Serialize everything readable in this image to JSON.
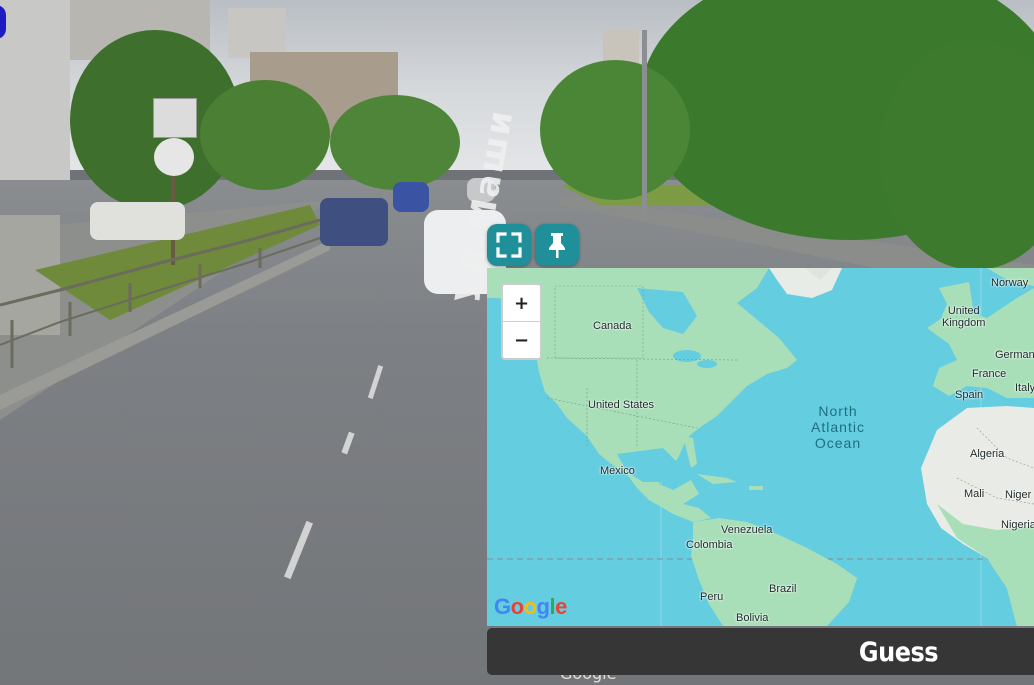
{
  "street_view": {
    "street_sign_text": "УЛ Маши",
    "watermark": "Google"
  },
  "map_tools": {
    "fullscreen_icon": "fullscreen-icon",
    "pin_icon": "pin-icon",
    "accent_color": "#1f8f9a"
  },
  "map": {
    "zoom_in": "+",
    "zoom_out": "−",
    "ocean_label": [
      "North",
      "Atlantic",
      "Ocean"
    ],
    "labels": {
      "canada": "Canada",
      "united_states": "United States",
      "mexico": "Mexico",
      "venezuela": "Venezuela",
      "colombia": "Colombia",
      "brazil": "Brazil",
      "peru": "Peru",
      "bolivia": "Bolivia",
      "norway": "Norway",
      "united_kingdom_1": "United",
      "united_kingdom_2": "Kingdom",
      "germany": "Germany",
      "france": "France",
      "italy": "Italy",
      "spain": "Spain",
      "algeria": "Algeria",
      "mali": "Mali",
      "niger": "Niger",
      "nigeria": "Nigeria"
    },
    "logo": {
      "letters": [
        "G",
        "o",
        "o",
        "g",
        "l",
        "e"
      ],
      "colors": [
        "#4285f4",
        "#ea4335",
        "#fbbc05",
        "#4285f4",
        "#34a853",
        "#ea4335"
      ]
    },
    "water_color": "#65cde0",
    "land_color": "#a8dfb9"
  },
  "guess_button": {
    "label": "Guess"
  }
}
